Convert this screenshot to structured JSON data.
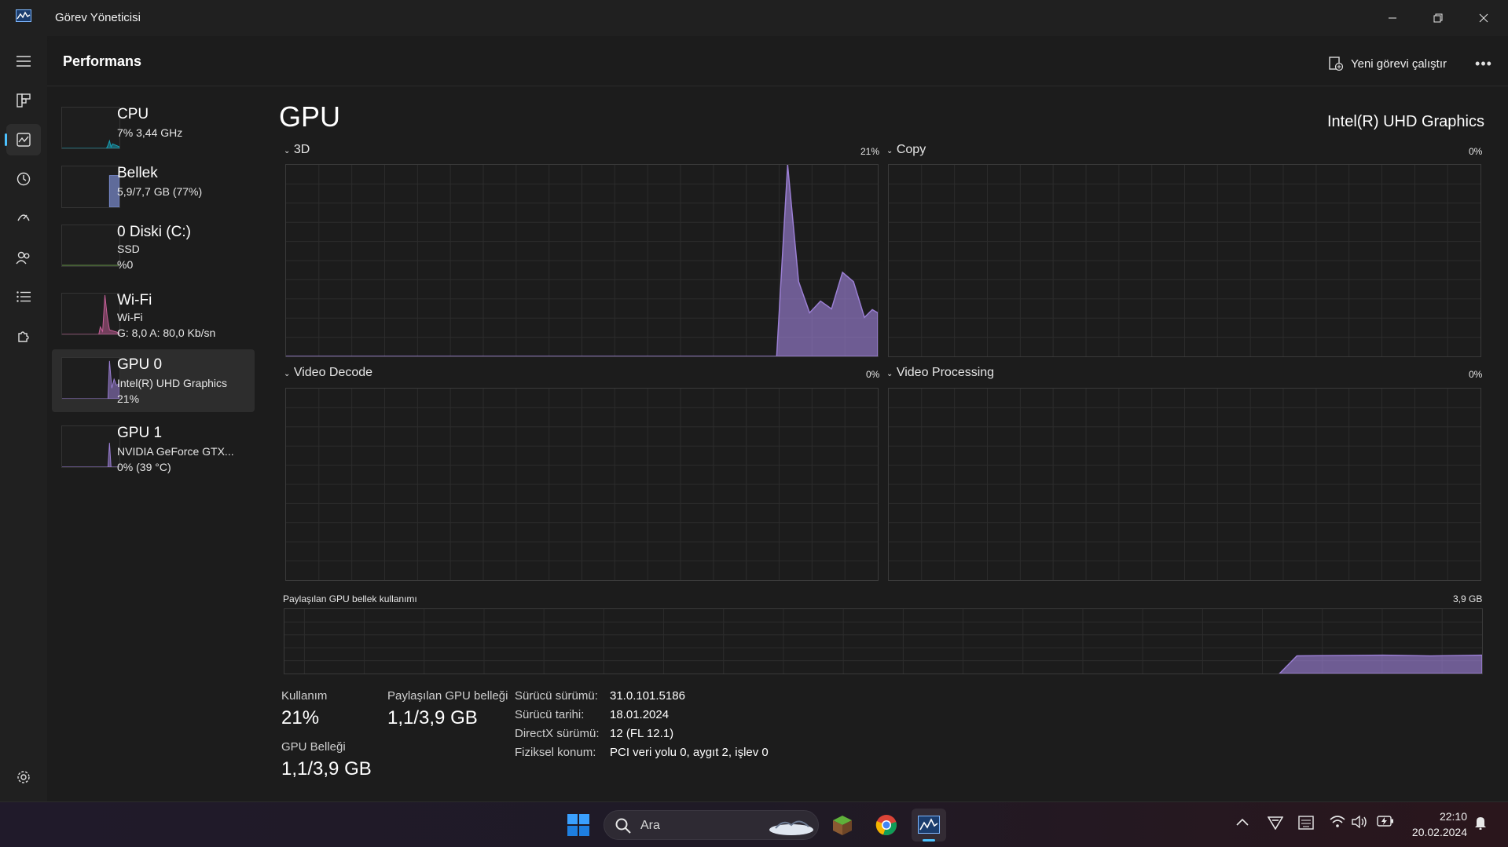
{
  "window": {
    "title": "Görev Yöneticisi"
  },
  "header": {
    "page_title": "Performans",
    "new_task_label": "Yeni görevi çalıştır"
  },
  "devices": [
    {
      "name": "CPU",
      "line1": "7% 3,44 GHz",
      "line2": "",
      "color": "#17a2b8"
    },
    {
      "name": "Bellek",
      "line1": "5,9/7,7 GB (77%)",
      "line2": "",
      "color": "#7a8ccf"
    },
    {
      "name": "0 Diski (C:)",
      "line1": "SSD",
      "line2": "%0",
      "color": "#6b9a4a"
    },
    {
      "name": "Wi-Fi",
      "line1": "Wi-Fi",
      "line2": "G: 8,0 A: 80,0 Kb/sn",
      "color": "#c8609a"
    },
    {
      "name": "GPU 0",
      "line1": "Intel(R) UHD Graphics",
      "line2": "21%",
      "color": "#9b7fd4"
    },
    {
      "name": "GPU 1",
      "line1": "NVIDIA GeForce GTX...",
      "line2": "0% (39 °C)",
      "color": "#9b7fd4"
    }
  ],
  "gpu": {
    "title": "GPU",
    "model": "Intel(R) UHD Graphics",
    "engines": [
      {
        "label": "3D",
        "percent": "21%"
      },
      {
        "label": "Copy",
        "percent": "0%"
      },
      {
        "label": "Video Decode",
        "percent": "0%"
      },
      {
        "label": "Video Processing",
        "percent": "0%"
      }
    ],
    "shared_mem_graph": {
      "label": "Paylaşılan GPU bellek kullanımı",
      "max": "3,9 GB"
    },
    "stats": {
      "usage_label": "Kullanım",
      "usage_value": "21%",
      "shared_label": "Paylaşılan GPU belleği",
      "shared_value": "1,1/3,9 GB",
      "gpu_mem_label": "GPU Belleği",
      "gpu_mem_value": "1,1/3,9 GB"
    },
    "info": [
      {
        "label": "Sürücü sürümü:",
        "value": "31.0.101.5186"
      },
      {
        "label": "Sürücü tarihi:",
        "value": "18.01.2024"
      },
      {
        "label": "DirectX sürümü:",
        "value": "12 (FL 12.1)"
      },
      {
        "label": "Fiziksel konum:",
        "value": "PCI veri yolu 0, aygıt 2, işlev 0"
      }
    ],
    "accent": "#9b7fd4"
  },
  "taskbar": {
    "search_placeholder": "Ara",
    "time": "22:10",
    "date": "20.02.2024"
  }
}
